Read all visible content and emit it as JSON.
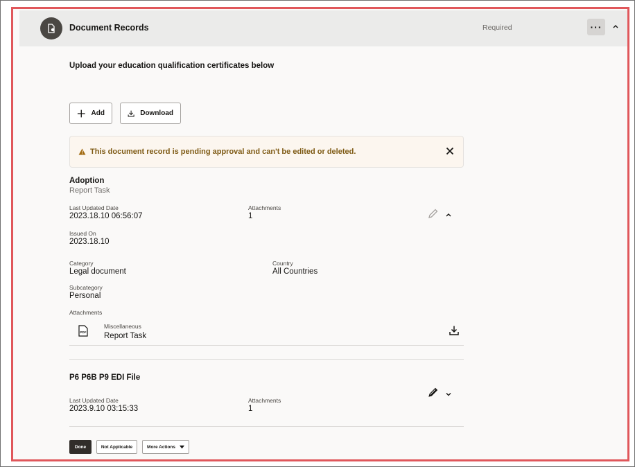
{
  "section": {
    "title": "Document Records",
    "status": "Required",
    "more_label": "···"
  },
  "intro": "Upload your education qualification certificates below",
  "toolbar": {
    "add_label": "Add",
    "download_label": "Download"
  },
  "alert": {
    "message": "This document record is pending approval and can't be edited or deleted."
  },
  "records": [
    {
      "title": "Adoption",
      "subtitle": "Report Task",
      "last_updated_label": "Last Updated Date",
      "last_updated": "2023.18.10 06:56:07",
      "attachments_label": "Attachments",
      "attachments_count": "1",
      "issued_on_label": "Issued On",
      "issued_on": "2023.18.10",
      "category_label": "Category",
      "category": "Legal document",
      "country_label": "Country",
      "country": "All Countries",
      "subcategory_label": "Subcategory",
      "subcategory": "Personal",
      "attachments_section_label": "Attachments",
      "attachment": {
        "category": "Miscellaneous",
        "name": "Report Task",
        "icon": "pdf-icon"
      }
    },
    {
      "title": "P6 P6B P9 EDI File",
      "last_updated_label": "Last Updated Date",
      "last_updated": "2023.9.10 03:15:33",
      "attachments_label": "Attachments",
      "attachments_count": "1"
    }
  ],
  "footer": {
    "done_label": "Done",
    "not_applicable_label": "Not Applicable",
    "more_actions_label": "More Actions"
  },
  "colors": {
    "accent_border": "#e0575b",
    "alert_text": "#7e5a14",
    "alert_bg": "#fcf6ef"
  }
}
